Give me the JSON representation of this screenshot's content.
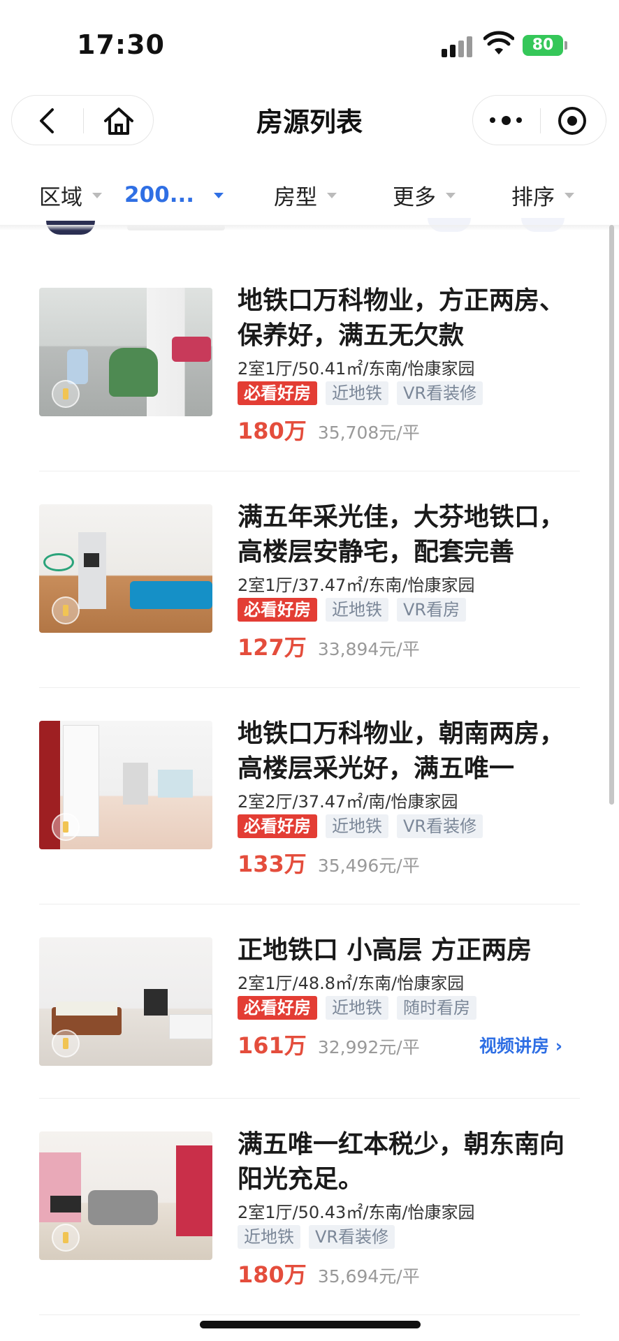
{
  "status": {
    "time": "17:30",
    "battery": "80"
  },
  "nav": {
    "title": "房源列表"
  },
  "filters": [
    {
      "label": "区域",
      "active": false
    },
    {
      "label": "200...",
      "active": true
    },
    {
      "label": "房型",
      "active": false
    },
    {
      "label": "更多",
      "active": false
    },
    {
      "label": "排序",
      "active": false
    }
  ],
  "listings": [
    {
      "title_l1": "地铁口万科物业，方正两房、",
      "title_l2": "保养好，满五无欠款",
      "meta": "2室1厅/50.41㎡/东南/怡康家园",
      "tags": [
        "必看好房",
        "近地铁",
        "VR看装修"
      ],
      "total": "180万",
      "unit_price": "35,708元/平"
    },
    {
      "title_l1": "满五年采光佳，大芬地铁口，",
      "title_l2": "高楼层安静宅，配套完善",
      "meta": "2室1厅/37.47㎡/东南/怡康家园",
      "tags": [
        "必看好房",
        "近地铁",
        "VR看房"
      ],
      "total": "127万",
      "unit_price": "33,894元/平"
    },
    {
      "title_l1": "地铁口万科物业，朝南两房，",
      "title_l2": "高楼层采光好，满五唯一",
      "meta": "2室2厅/37.47㎡/南/怡康家园",
      "tags": [
        "必看好房",
        "近地铁",
        "VR看装修"
      ],
      "total": "133万",
      "unit_price": "35,496元/平"
    },
    {
      "title_l1": "正地铁口 小高层 方正两房",
      "title_l2": "",
      "meta": "2室1厅/48.8㎡/东南/怡康家园",
      "tags": [
        "必看好房",
        "近地铁",
        "随时看房"
      ],
      "total": "161万",
      "unit_price": "32,992元/平",
      "video_link": "视频讲房"
    },
    {
      "title_l1": "满五唯一红本税少，朝东南向",
      "title_l2": "阳光充足。",
      "meta": "2室1厅/50.43㎡/东南/怡康家园",
      "tags": [
        "近地铁",
        "VR看装修"
      ],
      "total": "180万",
      "unit_price": "35,694元/平"
    }
  ],
  "colors": {
    "accent_blue": "#2f6fe4",
    "price_red": "#e44d3c",
    "hot_tag": "#e33d34"
  }
}
